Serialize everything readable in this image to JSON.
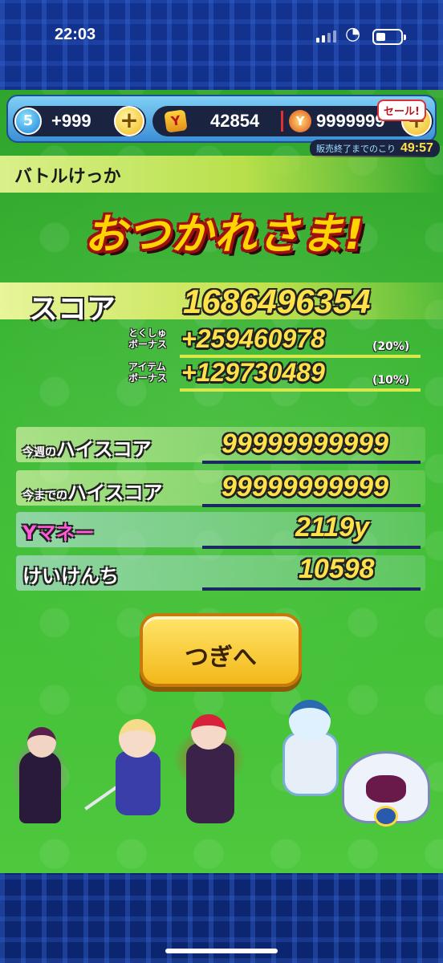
{
  "status_bar": {
    "time": "22:03"
  },
  "currency": {
    "energy_level": "5",
    "energy_amount": "+999",
    "money_icon": "Y",
    "money_amount": "42854",
    "gem_icon": "Y",
    "gem_amount": "9999999",
    "sale_badge": "セール!",
    "sale_timer_label": "販売終了までのこり",
    "sale_timer_value": "49:57"
  },
  "header": {
    "title": "バトルけっか",
    "banner": "おつかれさま!"
  },
  "score": {
    "label": "スコア",
    "value": "1686496354",
    "bonuses": [
      {
        "label_top": "とくしゅ",
        "label_bottom": "ボーナス",
        "value": "+259460978",
        "percent": "(20%)"
      },
      {
        "label_top": "アイテム",
        "label_bottom": "ボーナス",
        "value": "+129730489",
        "percent": "(10%)"
      }
    ]
  },
  "stats": [
    {
      "label_small": "今週の",
      "label": "ハイスコア",
      "value": "99999999999"
    },
    {
      "label_small": "今までの",
      "label": "ハイスコア",
      "value": "99999999999"
    },
    {
      "label_small": "",
      "label": "Yマネー",
      "value": "2119y"
    },
    {
      "label_small": "",
      "label": "けいけんち",
      "value": "10598"
    }
  ],
  "next_button": "つぎへ",
  "icons": {
    "plus": "plus-icon",
    "energy": "energy-icon",
    "money": "money-icon",
    "gem": "gem-icon",
    "wifi": "wifi-icon",
    "battery": "battery-icon",
    "signal": "signal-icon"
  }
}
